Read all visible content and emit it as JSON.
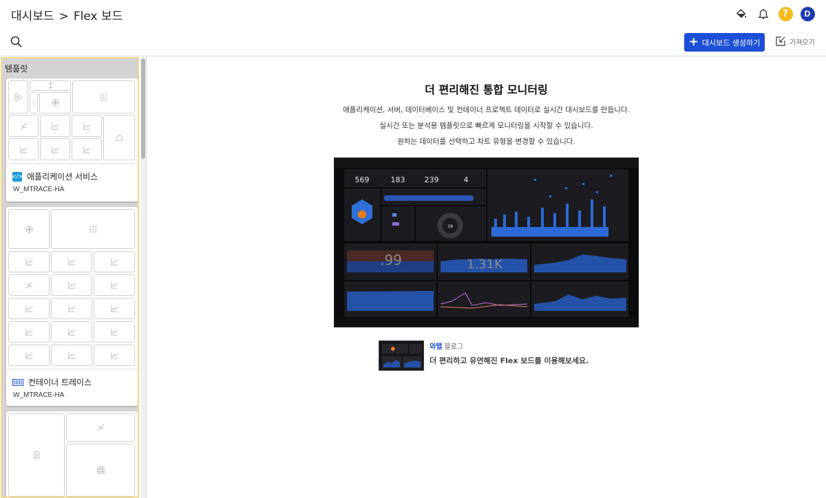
{
  "header": {
    "breadcrumb": [
      "대시보드",
      "Flex 보드"
    ],
    "breadcrumb_separator": ">",
    "icons": [
      "paint-bucket-icon",
      "bell-icon",
      "help-icon",
      "avatar"
    ],
    "help_label": "?",
    "avatar_initial": "D",
    "colors": {
      "help": "#f5b91a",
      "avatar": "#1c3bb0"
    }
  },
  "toolbar": {
    "search_icon": "search-icon",
    "create_label": "대시보드 생성하기",
    "create_icon": "plus-icon",
    "import_label": "가져오기",
    "import_icon": "import-icon",
    "accent": "#1d4fd8"
  },
  "sidebar": {
    "title": "템플릿",
    "templates": [
      {
        "name": "애플리케이션 서비스",
        "sub": "W_MTRACE-HA",
        "icon": "code-icon"
      },
      {
        "name": "컨테이너 트레이스",
        "sub": "W_MTRACE-HA",
        "icon": "container-icon"
      },
      {
        "name": "",
        "sub": "",
        "icon": ""
      }
    ]
  },
  "main": {
    "title": "더 편리해진 통합 모니터링",
    "description": [
      "애플리케이션, 서버, 데이터베이스 및 컨테이너 프로젝트 데이터로 실시간 대시보드를 만듭니다.",
      "실시간 또는 분석용 템플릿으로 빠르게 모니터링을 시작할 수 있습니다.",
      "원하는 데이터를 선택하고 차트 유형을 변경할 수 있습니다."
    ],
    "preview": {
      "stats": [
        {
          "value": "569"
        },
        {
          "value": "183"
        },
        {
          "value": "239"
        },
        {
          "value": "4"
        }
      ],
      "big_numbers": [
        ".99",
        "1.31K"
      ],
      "donut_value": "18"
    },
    "blog": {
      "brand": "와탭",
      "category": "블로그",
      "text": "더 편리하고 유연해진 Flex 보드를 이용해보세요."
    }
  }
}
